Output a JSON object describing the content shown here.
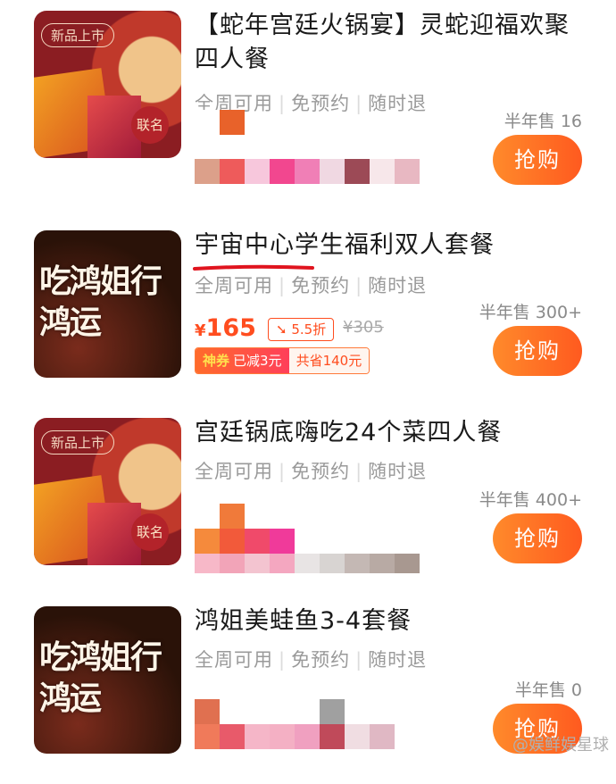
{
  "items": [
    {
      "title": "【蛇年宫廷火锅宴】灵蛇迎福欢聚四人餐",
      "tags": [
        "全周可用",
        "免预约",
        "随时退"
      ],
      "sales": "半年售 16",
      "buy_label": "抢购",
      "thumb_tag": "新品上市",
      "thumb_seal": "联名"
    },
    {
      "title": "宇宙中心学生福利双人套餐",
      "tags": [
        "全周可用",
        "免预约",
        "随时退"
      ],
      "sales": "半年售 300+",
      "buy_label": "抢购",
      "thumb_text": "吃鸿姐行鸿运",
      "price_currency": "¥",
      "price": "165",
      "discount": "5.5折",
      "original_price": "¥305",
      "coupon_badge": "神券",
      "coupon_reduced": "已减3元",
      "coupon_saved": "共省140元"
    },
    {
      "title": "宫廷锅底嗨吃24个菜四人餐",
      "tags": [
        "全周可用",
        "免预约",
        "随时退"
      ],
      "sales": "半年售 400+",
      "buy_label": "抢购",
      "thumb_tag": "新品上市",
      "thumb_seal": "联名"
    },
    {
      "title": "鸿姐美蛙鱼3-4套餐",
      "tags": [
        "全周可用",
        "免预约",
        "随时退"
      ],
      "sales": "半年售 0",
      "buy_label": "抢购",
      "thumb_text": "吃鸿姐行鸿运"
    }
  ],
  "watermark": "@娱鲜娱星球",
  "colors": {
    "accent": "#ff5a1f",
    "underline": "#e0141e"
  },
  "icons": {
    "discount_arrow": "down-arrow-icon"
  }
}
